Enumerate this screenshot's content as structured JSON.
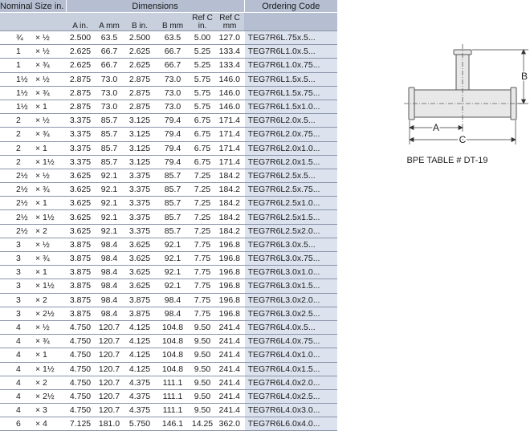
{
  "table": {
    "header": {
      "nominal": "Nominal Size in.",
      "dimensions": "Dimensions",
      "ordering": "Ordering Code",
      "col_a_in": "A in.",
      "col_a_mm": "A mm",
      "col_b_in": "B in.",
      "col_b_mm": "B mm",
      "col_c_in": "Ref C in.",
      "col_c_mm": "Ref C mm"
    },
    "rows": [
      [
        "¾",
        "× ½",
        "2.500",
        "63.5",
        "2.500",
        "63.5",
        "5.00",
        "127.0",
        "TEG7R6L.75x.5..."
      ],
      [
        "1",
        "× ½",
        "2.625",
        "66.7",
        "2.625",
        "66.7",
        "5.25",
        "133.4",
        "TEG7R6L1.0x.5..."
      ],
      [
        "1",
        "× ¾",
        "2.625",
        "66.7",
        "2.625",
        "66.7",
        "5.25",
        "133.4",
        "TEG7R6L1.0x.75..."
      ],
      [
        "1½",
        "× ½",
        "2.875",
        "73.0",
        "2.875",
        "73.0",
        "5.75",
        "146.0",
        "TEG7R6L1.5x.5..."
      ],
      [
        "1½",
        "× ¾",
        "2.875",
        "73.0",
        "2.875",
        "73.0",
        "5.75",
        "146.0",
        "TEG7R6L1.5x.75..."
      ],
      [
        "1½",
        "× 1",
        "2.875",
        "73.0",
        "2.875",
        "73.0",
        "5.75",
        "146.0",
        "TEG7R6L1.5x1.0..."
      ],
      [
        "2",
        "× ½",
        "3.375",
        "85.7",
        "3.125",
        "79.4",
        "6.75",
        "171.4",
        "TEG7R6L2.0x.5..."
      ],
      [
        "2",
        "× ¾",
        "3.375",
        "85.7",
        "3.125",
        "79.4",
        "6.75",
        "171.4",
        "TEG7R6L2.0x.75..."
      ],
      [
        "2",
        "× 1",
        "3.375",
        "85.7",
        "3.125",
        "79.4",
        "6.75",
        "171.4",
        "TEG7R6L2.0x1.0..."
      ],
      [
        "2",
        "× 1½",
        "3.375",
        "85.7",
        "3.125",
        "79.4",
        "6.75",
        "171.4",
        "TEG7R6L2.0x1.5..."
      ],
      [
        "2½",
        "× ½",
        "3.625",
        "92.1",
        "3.375",
        "85.7",
        "7.25",
        "184.2",
        "TEG7R6L2.5x.5..."
      ],
      [
        "2½",
        "× ¾",
        "3.625",
        "92.1",
        "3.375",
        "85.7",
        "7.25",
        "184.2",
        "TEG7R6L2.5x.75..."
      ],
      [
        "2½",
        "× 1",
        "3.625",
        "92.1",
        "3.375",
        "85.7",
        "7.25",
        "184.2",
        "TEG7R6L2.5x1.0..."
      ],
      [
        "2½",
        "× 1½",
        "3.625",
        "92.1",
        "3.375",
        "85.7",
        "7.25",
        "184.2",
        "TEG7R6L2.5x1.5..."
      ],
      [
        "2½",
        "× 2",
        "3.625",
        "92.1",
        "3.375",
        "85.7",
        "7.25",
        "184.2",
        "TEG7R6L2.5x2.0..."
      ],
      [
        "3",
        "× ½",
        "3.875",
        "98.4",
        "3.625",
        "92.1",
        "7.75",
        "196.8",
        "TEG7R6L3.0x.5..."
      ],
      [
        "3",
        "× ¾",
        "3.875",
        "98.4",
        "3.625",
        "92.1",
        "7.75",
        "196.8",
        "TEG7R6L3.0x.75..."
      ],
      [
        "3",
        "× 1",
        "3.875",
        "98.4",
        "3.625",
        "92.1",
        "7.75",
        "196.8",
        "TEG7R6L3.0x1.0..."
      ],
      [
        "3",
        "× 1½",
        "3.875",
        "98.4",
        "3.625",
        "92.1",
        "7.75",
        "196.8",
        "TEG7R6L3.0x1.5..."
      ],
      [
        "3",
        "× 2",
        "3.875",
        "98.4",
        "3.875",
        "98.4",
        "7.75",
        "196.8",
        "TEG7R6L3.0x2.0..."
      ],
      [
        "3",
        "× 2½",
        "3.875",
        "98.4",
        "3.875",
        "98.4",
        "7.75",
        "196.8",
        "TEG7R6L3.0x2.5..."
      ],
      [
        "4",
        "× ½",
        "4.750",
        "120.7",
        "4.125",
        "104.8",
        "9.50",
        "241.4",
        "TEG7R6L4.0x.5..."
      ],
      [
        "4",
        "× ¾",
        "4.750",
        "120.7",
        "4.125",
        "104.8",
        "9.50",
        "241.4",
        "TEG7R6L4.0x.75..."
      ],
      [
        "4",
        "× 1",
        "4.750",
        "120.7",
        "4.125",
        "104.8",
        "9.50",
        "241.4",
        "TEG7R6L4.0x1.0..."
      ],
      [
        "4",
        "× 1½",
        "4.750",
        "120.7",
        "4.125",
        "104.8",
        "9.50",
        "241.4",
        "TEG7R6L4.0x1.5..."
      ],
      [
        "4",
        "× 2",
        "4.750",
        "120.7",
        "4.375",
        "111.1",
        "9.50",
        "241.4",
        "TEG7R6L4.0x2.0..."
      ],
      [
        "4",
        "× 2½",
        "4.750",
        "120.7",
        "4.375",
        "111.1",
        "9.50",
        "241.4",
        "TEG7R6L4.0x2.5..."
      ],
      [
        "4",
        "× 3",
        "4.750",
        "120.7",
        "4.375",
        "111.1",
        "9.50",
        "241.4",
        "TEG7R6L4.0x3.0..."
      ],
      [
        "6",
        "× 4",
        "7.125",
        "181.0",
        "5.750",
        "146.1",
        "14.25",
        "362.0",
        "TEG7R6L6.0x4.0..."
      ]
    ]
  },
  "diagram": {
    "label_a": "A",
    "label_b": "B",
    "label_c": "C",
    "caption": "BPE TABLE # DT-19"
  },
  "colors": {
    "header_dark": "#b5bfd1",
    "header_light": "#c8d0de",
    "ordering_cell": "#dde3ee",
    "row_rule": "#8a94a8",
    "pipe_fill": "#e8e8e8",
    "pipe_stroke": "#555555"
  }
}
